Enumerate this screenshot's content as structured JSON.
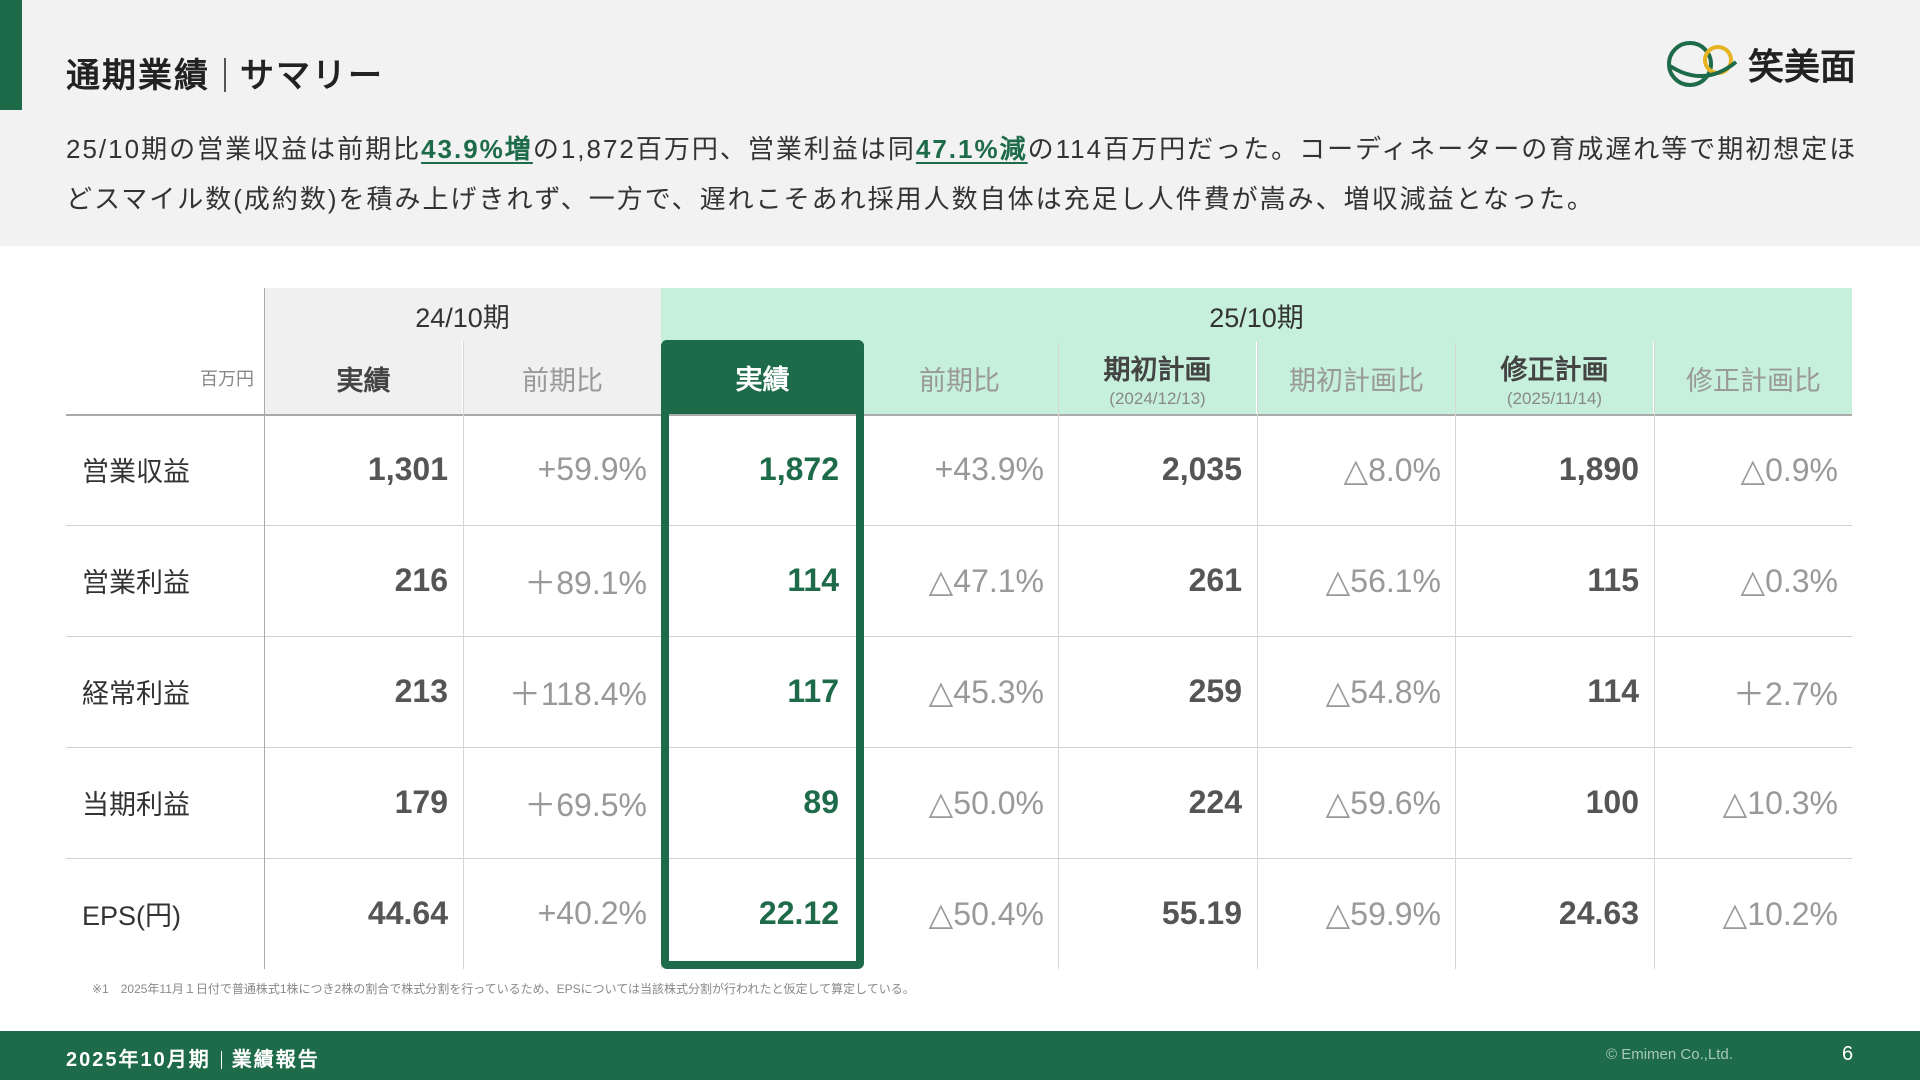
{
  "header": {
    "title_main": "通期業績",
    "title_sub": "サマリー",
    "logo_text": "笑美面"
  },
  "summary": {
    "p1": "25/10期の営業収益は前期比",
    "hl1": "43.9%増",
    "p2": "の1,872百万円、営業利益は同",
    "hl2": "47.1%減",
    "p3": "の114百万円だった。コーディネーターの育成遅れ等で期初想定ほどスマイル数(成約数)を積み上げきれず、一方で、遅れこそあれ採用人数自体は充足し人件費が嵩み、増収減益となった。"
  },
  "table": {
    "unit": "百万円",
    "period_prev": "24/10期",
    "period_curr": "25/10期",
    "columns": [
      {
        "label": "実績",
        "sub": ""
      },
      {
        "label": "前期比",
        "sub": ""
      },
      {
        "label": "実績",
        "sub": ""
      },
      {
        "label": "前期比",
        "sub": ""
      },
      {
        "label": "期初計画",
        "sub": "(2024/12/13)"
      },
      {
        "label": "期初計画比",
        "sub": ""
      },
      {
        "label": "修正計画",
        "sub": "(2025/11/14)"
      },
      {
        "label": "修正計画比",
        "sub": ""
      }
    ],
    "rows": [
      {
        "label": "営業収益",
        "v": [
          "1,301",
          "+59.9%",
          "1,872",
          "+43.9%",
          "2,035",
          "△8.0%",
          "1,890",
          "△0.9%"
        ]
      },
      {
        "label": "営業利益",
        "v": [
          "216",
          "＋89.1%",
          "114",
          "△47.1%",
          "261",
          "△56.1%",
          "115",
          "△0.3%"
        ]
      },
      {
        "label": "経常利益",
        "v": [
          "213",
          "＋118.4%",
          "117",
          "△45.3%",
          "259",
          "△54.8%",
          "114",
          "＋2.7%"
        ]
      },
      {
        "label": "当期利益",
        "v": [
          "179",
          "＋69.5%",
          "89",
          "△50.0%",
          "224",
          "△59.6%",
          "100",
          "△10.3%"
        ]
      },
      {
        "label": "EPS(円)",
        "v": [
          "44.64",
          "+40.2%",
          "22.12",
          "△50.4%",
          "55.19",
          "△59.9%",
          "24.63",
          "△10.2%"
        ]
      }
    ]
  },
  "footnote": "※1　2025年11月１日付で普通株式1株につき2株の割合で株式分割を行っているため、EPSについては当該株式分割が行われたと仮定して算定している。",
  "footer": {
    "period": "2025年10月期",
    "report": "業績報告",
    "copyright": "© Emimen Co.,Ltd.",
    "page": "6"
  },
  "colors": {
    "brand_green": "#1e6b4a",
    "header_mint": "#c6efdc",
    "logo_gold": "#e6b422"
  }
}
